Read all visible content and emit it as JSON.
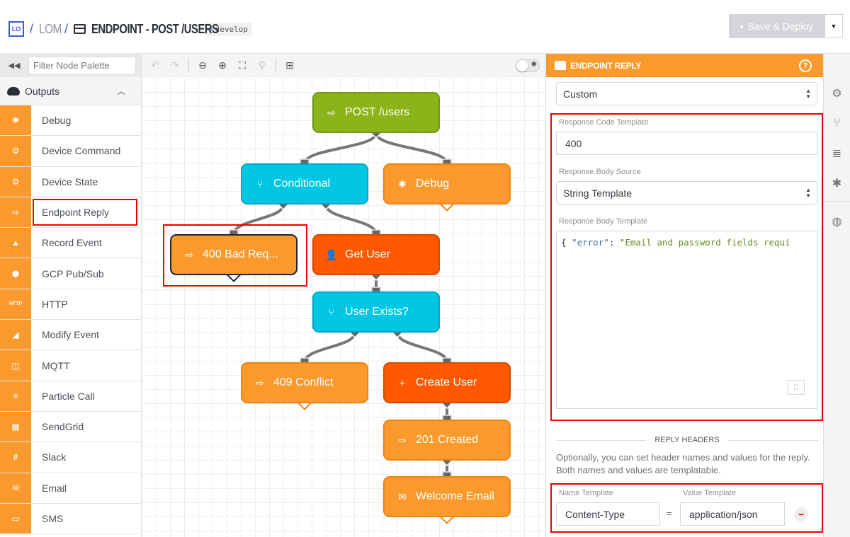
{
  "header": {
    "logo": "LO",
    "app": "LOM",
    "title": "ENDPOINT - POST /USERS",
    "branch": "develop",
    "deploy_label": "Save & Deploy"
  },
  "palette": {
    "filter_placeholder": "Filter Node Palette",
    "group": "Outputs",
    "items": [
      {
        "label": "Debug",
        "icon": "bug"
      },
      {
        "label": "Device Command",
        "icon": "chip-command"
      },
      {
        "label": "Device State",
        "icon": "chip-state"
      },
      {
        "label": "Endpoint Reply",
        "icon": "reply",
        "highlighted": true
      },
      {
        "label": "Record Event",
        "icon": "event-add"
      },
      {
        "label": "GCP Pub/Sub",
        "icon": "gcp"
      },
      {
        "label": "HTTP",
        "icon": "HTTP"
      },
      {
        "label": "Modify Event",
        "icon": "event-edit"
      },
      {
        "label": "MQTT",
        "icon": "mqtt"
      },
      {
        "label": "Particle Call",
        "icon": "particle"
      },
      {
        "label": "SendGrid",
        "icon": "sendgrid"
      },
      {
        "label": "Slack",
        "icon": "slack"
      },
      {
        "label": "Email",
        "icon": "envelope"
      },
      {
        "label": "SMS",
        "icon": "sms"
      }
    ]
  },
  "canvas": {
    "nodes": [
      {
        "id": "post",
        "label": "POST /users",
        "type": "trigger",
        "color": "#8db31b"
      },
      {
        "id": "cond",
        "label": "Conditional",
        "type": "conditional",
        "color": "#00c6e3"
      },
      {
        "id": "debug",
        "label": "Debug",
        "type": "debug",
        "color": "#fb9a2c"
      },
      {
        "id": "bad",
        "label": "400 Bad Req...",
        "type": "reply",
        "color": "#fb9a2c",
        "selected": true
      },
      {
        "id": "getuser",
        "label": "Get User",
        "type": "user-get",
        "color": "#ff5800"
      },
      {
        "id": "exists",
        "label": "User Exists?",
        "type": "conditional",
        "color": "#00c6e3"
      },
      {
        "id": "conflict",
        "label": "409 Conflict",
        "type": "reply",
        "color": "#fb9a2c"
      },
      {
        "id": "create",
        "label": "Create User",
        "type": "user-create",
        "color": "#ff5800"
      },
      {
        "id": "created",
        "label": "201 Created",
        "type": "reply",
        "color": "#fb9a2c"
      },
      {
        "id": "welcome",
        "label": "Welcome Email",
        "type": "email",
        "color": "#fb9a2c"
      }
    ],
    "edges": [
      [
        "post",
        "cond"
      ],
      [
        "post",
        "debug"
      ],
      [
        "cond",
        "bad"
      ],
      [
        "cond",
        "getuser"
      ],
      [
        "getuser",
        "exists"
      ],
      [
        "exists",
        "conflict"
      ],
      [
        "exists",
        "create"
      ],
      [
        "create",
        "created"
      ],
      [
        "created",
        "welcome"
      ]
    ]
  },
  "props": {
    "title": "ENDPOINT REPLY",
    "reply_type": "Custom",
    "code_label": "Response Code Template",
    "code_value": "400",
    "source_label": "Response Body Source",
    "source_value": "String Template",
    "body_label": "Response Body Template",
    "body_key": "\"error\"",
    "body_value": "\"Email and password fields requi",
    "headers_title": "REPLY HEADERS",
    "headers_help": "Optionally, you can set header names and values for the reply. Both names and values are templatable.",
    "name_label": "Name Template",
    "value_label": "Value Template",
    "header_name": "Content-Type",
    "header_value": "application/json"
  },
  "colors": {
    "accent": "#fb9a2c",
    "highlight": "#ee0000"
  }
}
